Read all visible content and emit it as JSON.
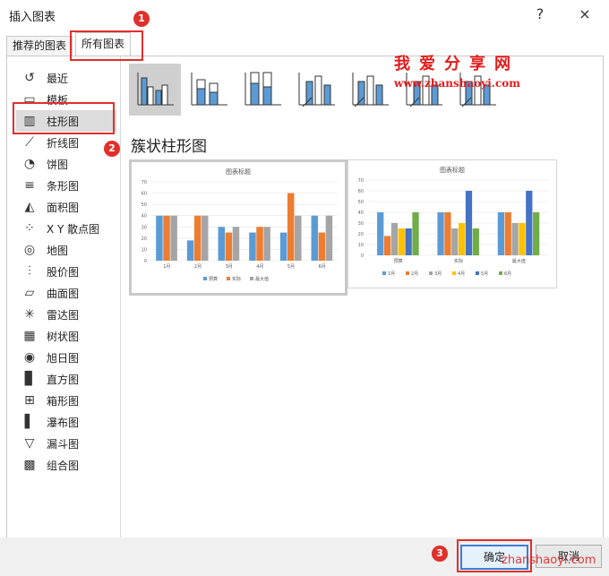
{
  "window": {
    "title": "插入图表",
    "help": "?",
    "close": "×"
  },
  "tabs": [
    {
      "label": "推荐的图表"
    },
    {
      "label": "所有图表"
    }
  ],
  "sidebar": {
    "items": [
      {
        "label": "最近",
        "icon": "recent-icon"
      },
      {
        "label": "模板",
        "icon": "template-folder-icon"
      },
      {
        "label": "柱形图",
        "icon": "column-chart-icon"
      },
      {
        "label": "折线图",
        "icon": "line-chart-icon"
      },
      {
        "label": "饼图",
        "icon": "pie-chart-icon"
      },
      {
        "label": "条形图",
        "icon": "bar-chart-icon"
      },
      {
        "label": "面积图",
        "icon": "area-chart-icon"
      },
      {
        "label": "X Y 散点图",
        "icon": "scatter-chart-icon"
      },
      {
        "label": "地图",
        "icon": "map-chart-icon"
      },
      {
        "label": "股价图",
        "icon": "stock-chart-icon"
      },
      {
        "label": "曲面图",
        "icon": "surface-chart-icon"
      },
      {
        "label": "雷达图",
        "icon": "radar-chart-icon"
      },
      {
        "label": "树状图",
        "icon": "treemap-chart-icon"
      },
      {
        "label": "旭日图",
        "icon": "sunburst-chart-icon"
      },
      {
        "label": "直方图",
        "icon": "histogram-chart-icon"
      },
      {
        "label": "箱形图",
        "icon": "box-chart-icon"
      },
      {
        "label": "瀑布图",
        "icon": "waterfall-chart-icon"
      },
      {
        "label": "漏斗图",
        "icon": "funnel-chart-icon"
      },
      {
        "label": "组合图",
        "icon": "combo-chart-icon"
      }
    ]
  },
  "subtypes": [
    {
      "name": "clustered-column-icon"
    },
    {
      "name": "stacked-column-icon"
    },
    {
      "name": "100-stacked-column-icon"
    },
    {
      "name": "3d-clustered-column-icon"
    },
    {
      "name": "3d-stacked-column-icon"
    },
    {
      "name": "3d-100-stacked-column-icon"
    },
    {
      "name": "3d-column-icon"
    }
  ],
  "selected_subtype_title": "簇状柱形图",
  "watermark": {
    "line1": "我爱分享网",
    "line2": "www.zhanshaoyi.com",
    "line3": "zhanshaoyi.com"
  },
  "markers": [
    "1",
    "2",
    "3"
  ],
  "buttons": {
    "ok": "确定",
    "cancel": "取消"
  },
  "colors": {
    "blue": "#5b9bd5",
    "orange": "#ed7d31",
    "gray": "#a5a5a5",
    "yellow": "#ffc000",
    "darkblue": "#4472c4",
    "green": "#70ad47",
    "red": "#e0302b"
  },
  "chart_data": [
    {
      "type": "bar",
      "title": "图表标题",
      "categories": [
        "1月",
        "2月",
        "3月",
        "4月",
        "5月",
        "6月"
      ],
      "series": [
        {
          "name": "预算",
          "values": [
            40,
            18,
            30,
            25,
            25,
            40
          ]
        },
        {
          "name": "实际",
          "values": [
            40,
            40,
            25,
            30,
            60,
            25
          ]
        },
        {
          "name": "最大值",
          "values": [
            40,
            40,
            30,
            30,
            40,
            40
          ]
        }
      ],
      "ylim": [
        0,
        70
      ],
      "yticks": [
        0,
        10,
        20,
        30,
        40,
        50,
        60,
        70
      ],
      "legend": "bottom"
    },
    {
      "type": "bar",
      "title": "图表标题",
      "categories": [
        "预算",
        "实际",
        "最大值"
      ],
      "series": [
        {
          "name": "1月",
          "values": [
            40,
            40,
            40
          ]
        },
        {
          "name": "2月",
          "values": [
            18,
            40,
            40
          ]
        },
        {
          "name": "3月",
          "values": [
            30,
            25,
            30
          ]
        },
        {
          "name": "4月",
          "values": [
            25,
            30,
            30
          ]
        },
        {
          "name": "5月",
          "values": [
            25,
            60,
            60
          ]
        },
        {
          "name": "6月",
          "values": [
            40,
            25,
            40
          ]
        }
      ],
      "ylim": [
        0,
        70
      ],
      "yticks": [
        0,
        10,
        20,
        30,
        40,
        50,
        60,
        70
      ],
      "legend": "bottom"
    }
  ]
}
